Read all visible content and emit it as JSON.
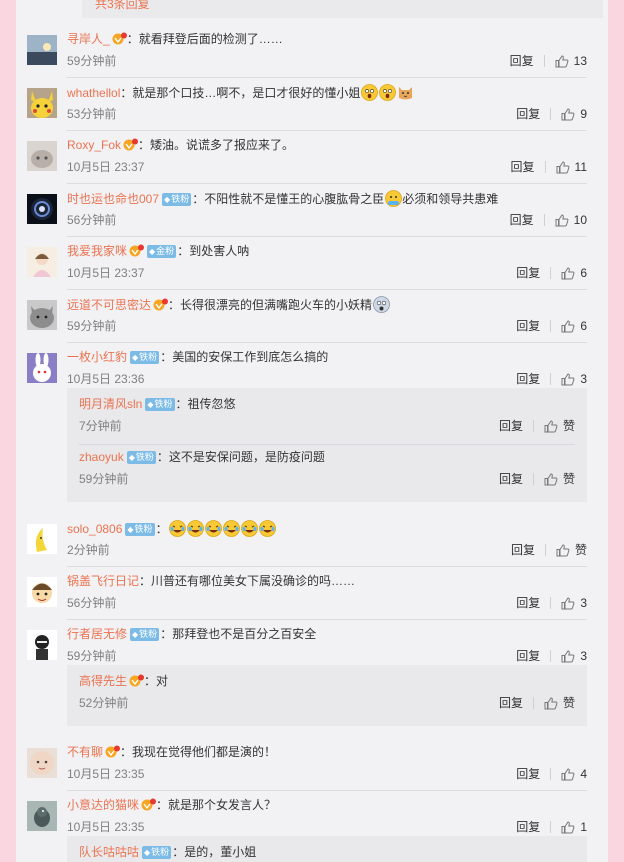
{
  "top_reply": {
    "text": "共3条回复"
  },
  "comments": [
    {
      "user": "寻岸人_",
      "vip": true,
      "badge": null,
      "text": "：就看拜登后面的检测了……",
      "emojis": [],
      "time": "59分钟前",
      "reply": "回复",
      "likes": "13",
      "avatar": "landscape"
    },
    {
      "user": "whathellol",
      "vip": false,
      "badge": null,
      "text": "：就是那个口技…啊不，是口才很好的懂小姐",
      "emojis": [
        "shock-emoji",
        "shock-emoji",
        "cat-emoji"
      ],
      "time": "53分钟前",
      "reply": "回复",
      "likes": "9",
      "avatar": "pikachu"
    },
    {
      "user": "Roxy_Fok",
      "vip": true,
      "badge": null,
      "text": "：矮油。说谎多了报应来了。",
      "emojis": [],
      "time": "10月5日 23:37",
      "reply": "回复",
      "likes": "11",
      "avatar": "cat"
    },
    {
      "user": "时也运也命也007",
      "vip": false,
      "badge": "铁粉",
      "text": "：不阳性就不是懂王的心腹肱骨之臣",
      "emojis": [
        "thinking-emoji"
      ],
      "text2": "必须和领导共患难",
      "time": "56分钟前",
      "reply": "回复",
      "likes": "10",
      "avatar": "galaxy"
    },
    {
      "user": "我爱我家咪",
      "vip": true,
      "badge": "金粉",
      "text": "：到处害人呐",
      "emojis": [],
      "time": "10月5日 23:37",
      "reply": "回复",
      "likes": "6",
      "avatar": "girl"
    },
    {
      "user": "远道不可思密达",
      "vip": true,
      "badge": null,
      "text": "：长得很漂亮的但满嘴跑火车的小妖精",
      "emojis": [
        "scared-emoji"
      ],
      "time": "59分钟前",
      "reply": "回复",
      "likes": "6",
      "avatar": "grey-cat"
    },
    {
      "user": "一枚小红豹",
      "vip": false,
      "badge": "铁粉",
      "text": "：美国的安保工作到底怎么搞的",
      "emojis": [],
      "time": "10月5日 23:36",
      "reply": "回复",
      "likes": "3",
      "avatar": "rabbit",
      "subs": [
        {
          "user": "明月清风sln",
          "vip": false,
          "badge": "铁粉",
          "text": "：祖传忽悠",
          "time": "7分钟前",
          "reply": "回复",
          "likes": "赞"
        },
        {
          "user": "zhaoyuk",
          "vip": false,
          "badge": "铁粉",
          "text": "：这不是安保问题，是防疫问题",
          "time": "59分钟前",
          "reply": "回复",
          "likes": "赞"
        }
      ]
    },
    {
      "user": "solo_0806",
      "vip": false,
      "badge": "铁粉",
      "text": "：",
      "emojis": [
        "laugh-cry-emoji",
        "laugh-cry-emoji",
        "laugh-cry-emoji",
        "laugh-cry-emoji",
        "laugh-cry-emoji",
        "laugh-cry-emoji"
      ],
      "time": "2分钟前",
      "reply": "回复",
      "likes": "赞",
      "avatar": "banana"
    },
    {
      "user": "锅盖飞行日记",
      "vip": false,
      "badge": null,
      "text": "：川普还有哪位美女下属没确诊的吗……",
      "emojis": [],
      "time": "56分钟前",
      "reply": "回复",
      "likes": "3",
      "avatar": "cartoon-boy"
    },
    {
      "user": "行者居无修",
      "vip": false,
      "badge": "铁粉",
      "text": "：那拜登也不是百分之百安全",
      "emojis": [],
      "time": "59分钟前",
      "reply": "回复",
      "likes": "3",
      "avatar": "ninja",
      "subs": [
        {
          "user": "高得先生",
          "vip": true,
          "badge": null,
          "text": "：对",
          "time": "52分钟前",
          "reply": "回复",
          "likes": "赞"
        }
      ]
    },
    {
      "user": "不有聊",
      "vip": true,
      "badge": null,
      "text": "：我现在觉得他们都是演的！",
      "emojis": [],
      "time": "10月5日 23:35",
      "reply": "回复",
      "likes": "4",
      "avatar": "baby"
    },
    {
      "user": "小意达的猫咪",
      "vip": true,
      "badge": null,
      "text": "：就是那个女发言人？",
      "emojis": [],
      "time": "10月5日 23:35",
      "reply": "回复",
      "likes": "1",
      "avatar": "bird",
      "subs": [
        {
          "user": "队长咕咕咕",
          "vip": false,
          "badge": "铁粉",
          "text": "：是的，董小姐",
          "time": "",
          "reply": "",
          "likes": ""
        }
      ]
    }
  ],
  "colors": {
    "name": "#eb7350",
    "badge": "#7cbbe6",
    "background": "#f9d6e0",
    "panel": "#f2f2f5"
  }
}
